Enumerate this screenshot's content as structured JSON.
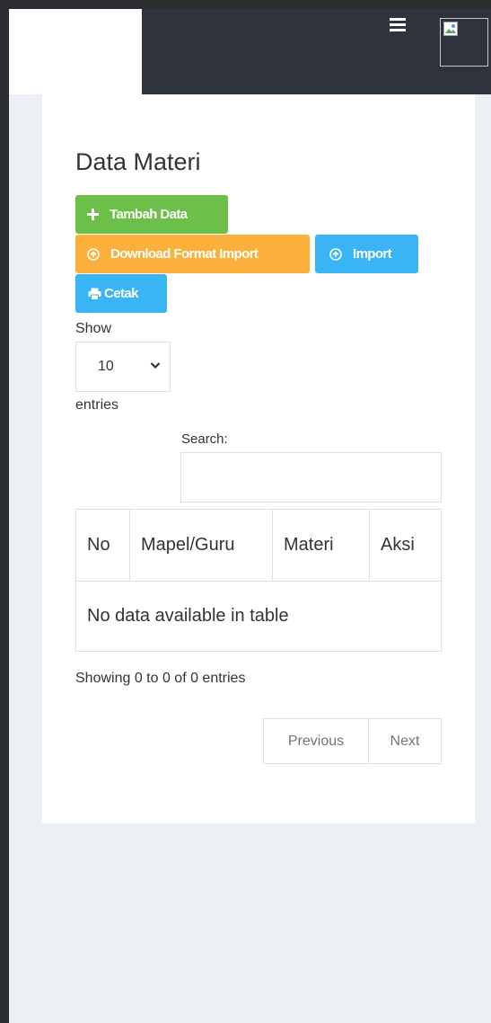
{
  "page": {
    "title": "Data Materi"
  },
  "toolbar": {
    "tambah_label": "Tambah Data",
    "download_label": "Download Format Import",
    "import_label": "Import",
    "cetak_label": "Cetak"
  },
  "length_control": {
    "show_label": "Show",
    "selected_value": "10",
    "entries_label": "entries"
  },
  "search": {
    "label": "Search:",
    "value": "",
    "placeholder": ""
  },
  "table": {
    "columns": [
      "No",
      "Mapel/Guru",
      "Materi",
      "Aksi"
    ],
    "empty_message": "No data available in table"
  },
  "info": {
    "text": "Showing 0 to 0 of 0 entries"
  },
  "pagination": {
    "previous_label": "Previous",
    "next_label": "Next"
  },
  "colors": {
    "navbar": "#2f333e",
    "green": "#6cc04a",
    "orange": "#fbb03b",
    "blue": "#39b4f5",
    "background": "#eceff4"
  },
  "icons": {
    "menu": "hamburger-icon",
    "avatar": "broken-image-icon",
    "tambah": "plus-icon",
    "download": "arrow-circle-icon",
    "import": "arrow-circle-icon",
    "cetak": "print-icon",
    "select": "chevron-down-icon"
  }
}
